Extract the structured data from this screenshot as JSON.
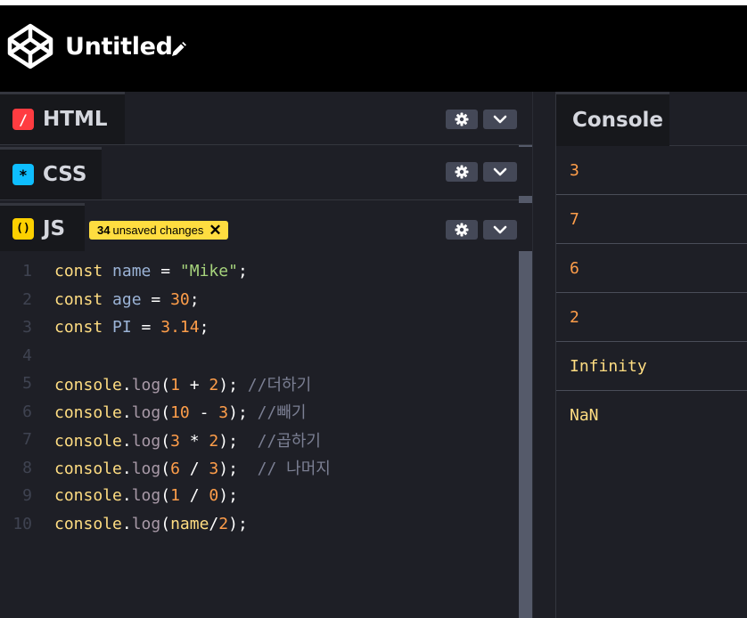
{
  "header": {
    "title": "Untitled"
  },
  "panes": {
    "html": {
      "label": "HTML",
      "icon_glyph": "/",
      "icon_color": "#ff3c41"
    },
    "css": {
      "label": "CSS",
      "icon_glyph": "*",
      "icon_color": "#0ebeff"
    },
    "js": {
      "label": "JS",
      "icon_glyph": "()",
      "icon_color": "#fcd000",
      "unsaved_count": "34",
      "unsaved_text": "unsaved changes"
    }
  },
  "editor": {
    "lines": [
      {
        "num": "1",
        "tokens": [
          [
            "kw",
            "const"
          ],
          [
            "p",
            " "
          ],
          [
            "v",
            "name"
          ],
          [
            "p",
            " = "
          ],
          [
            "s",
            "\"Mike\""
          ],
          [
            "p",
            ";"
          ]
        ]
      },
      {
        "num": "2",
        "tokens": [
          [
            "kw",
            "const"
          ],
          [
            "p",
            " "
          ],
          [
            "v",
            "age"
          ],
          [
            "p",
            " = "
          ],
          [
            "n",
            "30"
          ],
          [
            "p",
            ";"
          ]
        ]
      },
      {
        "num": "3",
        "tokens": [
          [
            "kw",
            "const"
          ],
          [
            "p",
            " "
          ],
          [
            "v",
            "PI"
          ],
          [
            "p",
            " = "
          ],
          [
            "n",
            "3.14"
          ],
          [
            "p",
            ";"
          ]
        ]
      },
      {
        "num": "4",
        "tokens": []
      },
      {
        "num": "5",
        "tokens": [
          [
            "kw",
            "console"
          ],
          [
            "p",
            "."
          ],
          [
            "m",
            "log"
          ],
          [
            "p",
            "("
          ],
          [
            "n",
            "1"
          ],
          [
            "p",
            " + "
          ],
          [
            "n",
            "2"
          ],
          [
            "p",
            "); "
          ],
          [
            "c",
            "//더하기"
          ]
        ]
      },
      {
        "num": "6",
        "tokens": [
          [
            "kw",
            "console"
          ],
          [
            "p",
            "."
          ],
          [
            "m",
            "log"
          ],
          [
            "p",
            "("
          ],
          [
            "n",
            "10"
          ],
          [
            "p",
            " - "
          ],
          [
            "n",
            "3"
          ],
          [
            "p",
            "); "
          ],
          [
            "c",
            "//빼기"
          ]
        ]
      },
      {
        "num": "7",
        "tokens": [
          [
            "kw",
            "console"
          ],
          [
            "p",
            "."
          ],
          [
            "m",
            "log"
          ],
          [
            "p",
            "("
          ],
          [
            "n",
            "3"
          ],
          [
            "p",
            " * "
          ],
          [
            "n",
            "2"
          ],
          [
            "p",
            ");  "
          ],
          [
            "c",
            "//곱하기"
          ]
        ]
      },
      {
        "num": "8",
        "tokens": [
          [
            "kw",
            "console"
          ],
          [
            "p",
            "."
          ],
          [
            "m",
            "log"
          ],
          [
            "p",
            "("
          ],
          [
            "n",
            "6"
          ],
          [
            "p",
            " / "
          ],
          [
            "n",
            "3"
          ],
          [
            "p",
            ");  "
          ],
          [
            "c",
            "// 나머지"
          ]
        ]
      },
      {
        "num": "9",
        "tokens": [
          [
            "kw",
            "console"
          ],
          [
            "p",
            "."
          ],
          [
            "m",
            "log"
          ],
          [
            "p",
            "("
          ],
          [
            "n",
            "1"
          ],
          [
            "p",
            " / "
          ],
          [
            "n",
            "0"
          ],
          [
            "p",
            ");"
          ]
        ]
      },
      {
        "num": "10",
        "tokens": [
          [
            "kw",
            "console"
          ],
          [
            "p",
            "."
          ],
          [
            "m",
            "log"
          ],
          [
            "p",
            "("
          ],
          [
            "kw",
            "name"
          ],
          [
            "p",
            "/"
          ],
          [
            "n",
            "2"
          ],
          [
            "p",
            ");"
          ]
        ]
      }
    ]
  },
  "console": {
    "label": "Console",
    "rows": [
      {
        "text": "3",
        "kind": "num"
      },
      {
        "text": "7",
        "kind": "num"
      },
      {
        "text": "6",
        "kind": "num"
      },
      {
        "text": "2",
        "kind": "num"
      },
      {
        "text": "Infinity",
        "kind": "str"
      },
      {
        "text": "NaN",
        "kind": "str"
      }
    ]
  }
}
